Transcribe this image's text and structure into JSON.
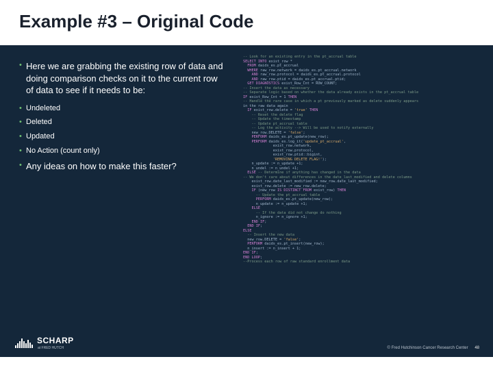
{
  "title": "Example #3 – Original Code",
  "bullets": {
    "main1": "Here we are grabbing the existing row of data and doing comparison checks on it to the current row of data to see if it needs to be:",
    "sub1": "Undeleted",
    "sub2": "Deleted",
    "sub3": "Updated",
    "sub4": "No Action (count only)",
    "main2": "Any ideas on how to make this faster?"
  },
  "code": "-- Look for an existing entry in the pt_accrual table\nSELECT INTO exist_row *\n  FROM daids_es.pt_accrual\n  WHERE raw_row.network = daids_es.pt_accrual.network\n    AND raw_row.protocol = daids_es.pt_accrual.protocol\n    AND raw_row.ptid = daids_es.pt_accrual.ptid;\n  GET DIAGNOSTICS exist_Row_Cnt = ROW_COUNT;\n-- Insert the data as necessary\n-- Separate logic based on whether the data already exists in the pt_accrual table\nIF exist_Row_Cnt = 1 THEN\n-- Handle the rare case in which a pt previously marked as delete suddenly appears\nin the raw data again\n  IF exist_row.delete = 'true' THEN\n    -- Reset the delete flag\n    -- Update the timestamp\n    -- Update pt_accrual table\n    -- Log the activity --> Will be used to notify externally\n    new_row.DELETE = 'false';\n    PERFORM daids_es.pt_update(new_row);\n    PERFORM daids_es.log_it('update_pt_accrual',\n              exist_row.network,\n              exist_row.protocol,\n              exist_row.ptid::bigint,\n              'REMOVING DELETE FLAG!');\n    n_update := n_update +1;\n    n_undel := n_undel +1;\n  ELSE -- Determine if anything has changed in the data\n-- We don't care about differences in the date_last_modified and delete columns\n    exist_row.date_last_modified := new_row.date_last_modified;\n    exist_row.delete := new_row.delete;\n    IF (new_row IS DISTINCT FROM exist_row) THEN\n      -- Update the pt_accrual table\n      PERFORM daids_es.pt_update(new_row);\n      n_update := n_update +1;\n    ELSE\n      -- If the data did not change do nothing\n      n_ignore := n_ignore +1;\n    END IF;\n  END IF;\nELSE\n  -- Insert the new data\n  new_row.DELETE = 'false';\n  PERFORM daids_es.pt_insert(new_row);\n  n_insert := n_insert + 1;\nEND IF;\nEND LOOP;\n--Process each row of raw standard enrollment data",
  "footer": {
    "brand": "SCHARP",
    "sub": "at FRED HUTCH"
  },
  "copy": "© Fred Hutchinson Cancer Research Center",
  "page": "48"
}
